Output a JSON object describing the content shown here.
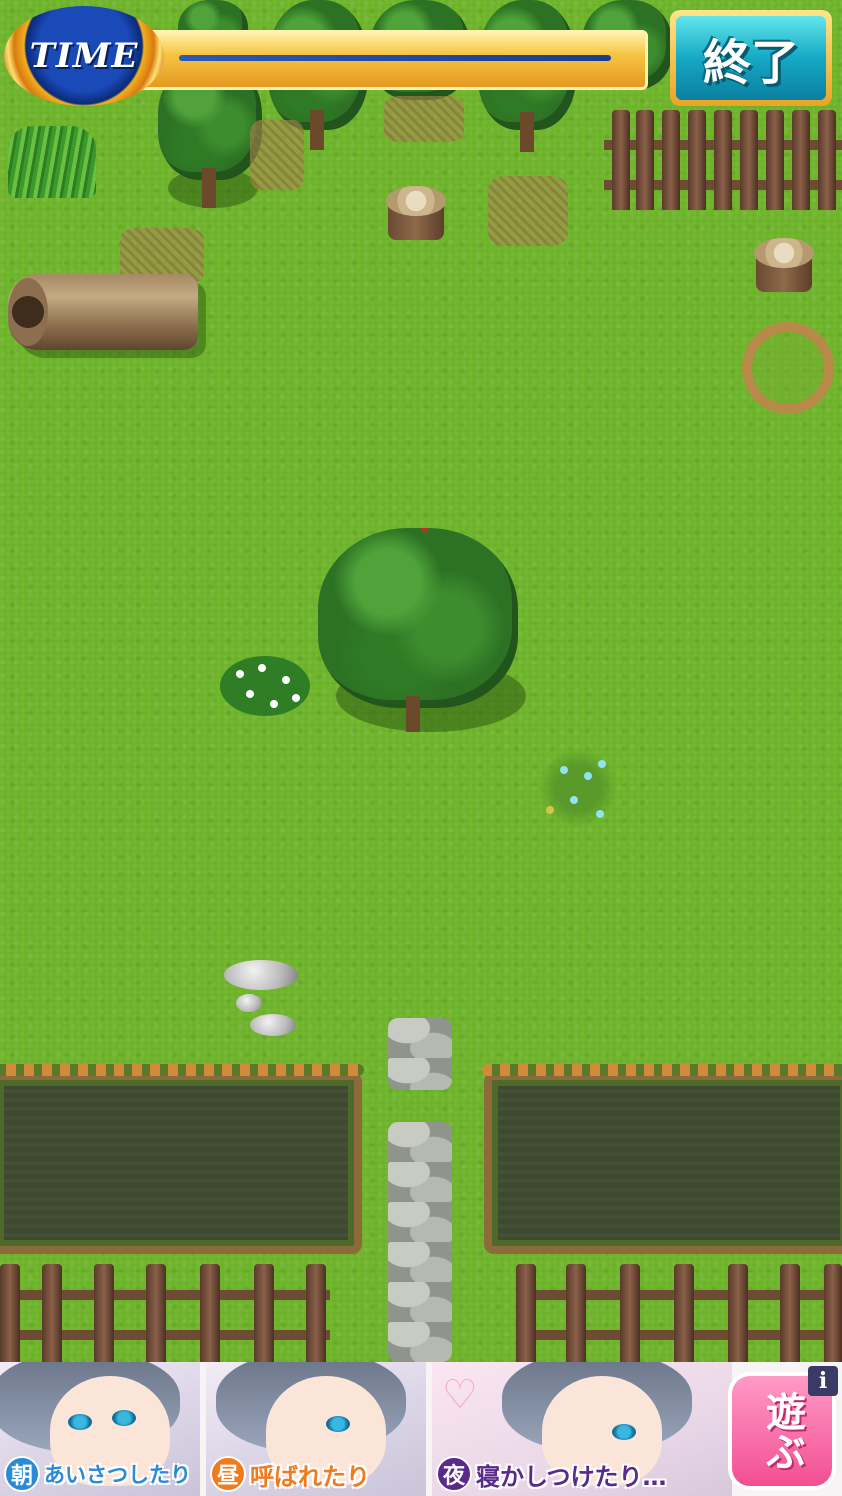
{
  "hud": {
    "time_label": "TIME",
    "time_remaining_fraction": 0.9,
    "end_button_label": "終了"
  },
  "ad": {
    "panels": [
      {
        "badge": "朝",
        "caption": "あいさつしたり",
        "badge_color": "#2a8ad8",
        "caption_color": "#2a8ad8"
      },
      {
        "badge": "昼",
        "caption": "呼ばれたり",
        "badge_color": "#f07a1c",
        "caption_color": "#f07a1c"
      },
      {
        "badge": "夜",
        "caption": "寝かしつけたり…",
        "badge_color": "#5a2a8a",
        "caption_color": "#5a2a8a"
      }
    ],
    "play_button_label": "遊ぶ",
    "info_label": "i"
  },
  "colors": {
    "grass": "#6fb52b",
    "time_badge": "#1a4ab8",
    "end_button": "#15a9c4",
    "play_button": "#f24f93"
  }
}
